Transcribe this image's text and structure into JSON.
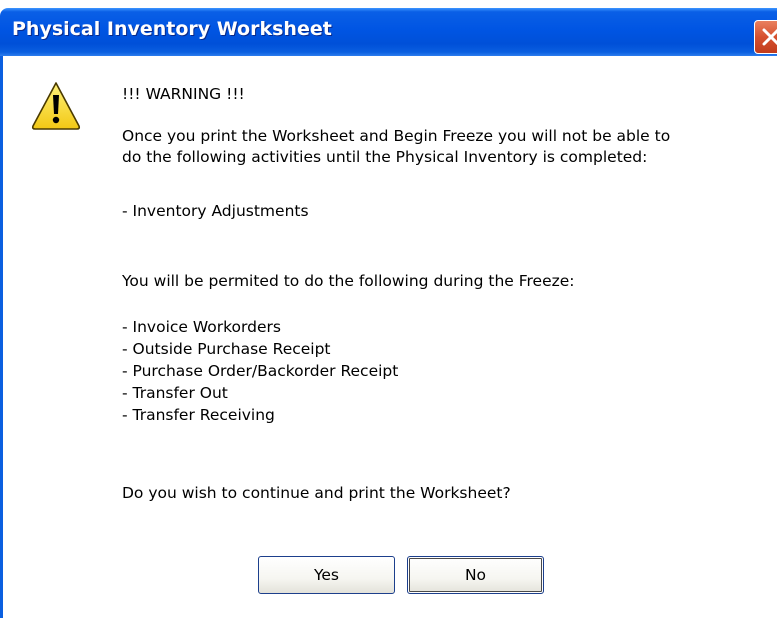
{
  "window": {
    "title": "Physical Inventory Worksheet"
  },
  "dialog": {
    "icon": "warning-icon",
    "heading": "!!! WARNING !!!",
    "intro_line1": "Once you print the Worksheet and Begin Freeze you will not be able to",
    "intro_line2": "do the following activities until the Physical Inventory is completed:",
    "blocked_items": [
      "- Inventory Adjustments"
    ],
    "permitted_intro": "You will be permited to do the following during the Freeze:",
    "permitted_items": [
      "- Invoice Workorders",
      "- Outside Purchase Receipt",
      "- Purchase Order/Backorder Receipt",
      "- Transfer Out",
      "- Transfer Receiving"
    ],
    "question": "Do you wish to continue and print the Worksheet?"
  },
  "buttons": {
    "yes_label": "Yes",
    "no_label": "No"
  },
  "colors": {
    "titlebar": "#0055e3",
    "close_button": "#d6502f",
    "warning_yellow": "#f8e23a"
  }
}
